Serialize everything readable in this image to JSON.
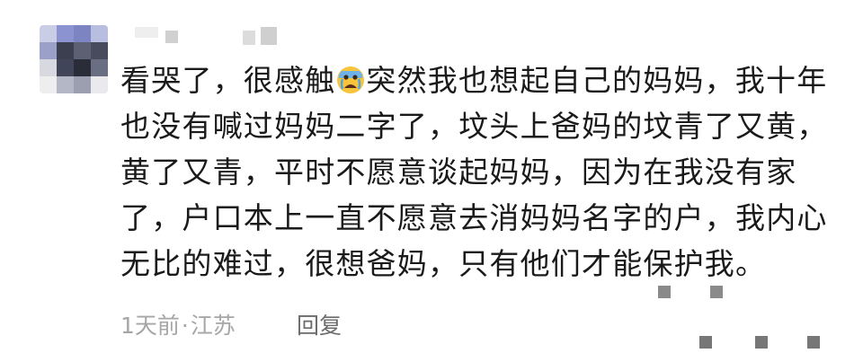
{
  "comment": {
    "avatar_alt": "avatar",
    "text_before_emoji": "看哭了，很感触",
    "emoji": "crying-face-emoji",
    "text_after_emoji": "突然我也想起自己的妈妈，我十年也没有喊过妈妈二字了，坟头上爸妈的坟青了又黄，黄了又青，平时不愿意谈起妈妈，因为在我没有家了，户口本上一直不愿意去消妈妈名字的户，我内心无比的难过，很想爸妈，只有他们才能保护我。",
    "time": "1天前",
    "separator": "·",
    "location": "江苏",
    "reply_label": "回复"
  },
  "colors": {
    "text": "#1a1a1a",
    "meta": "#a6a6a6",
    "reply": "#6b6b6b"
  }
}
